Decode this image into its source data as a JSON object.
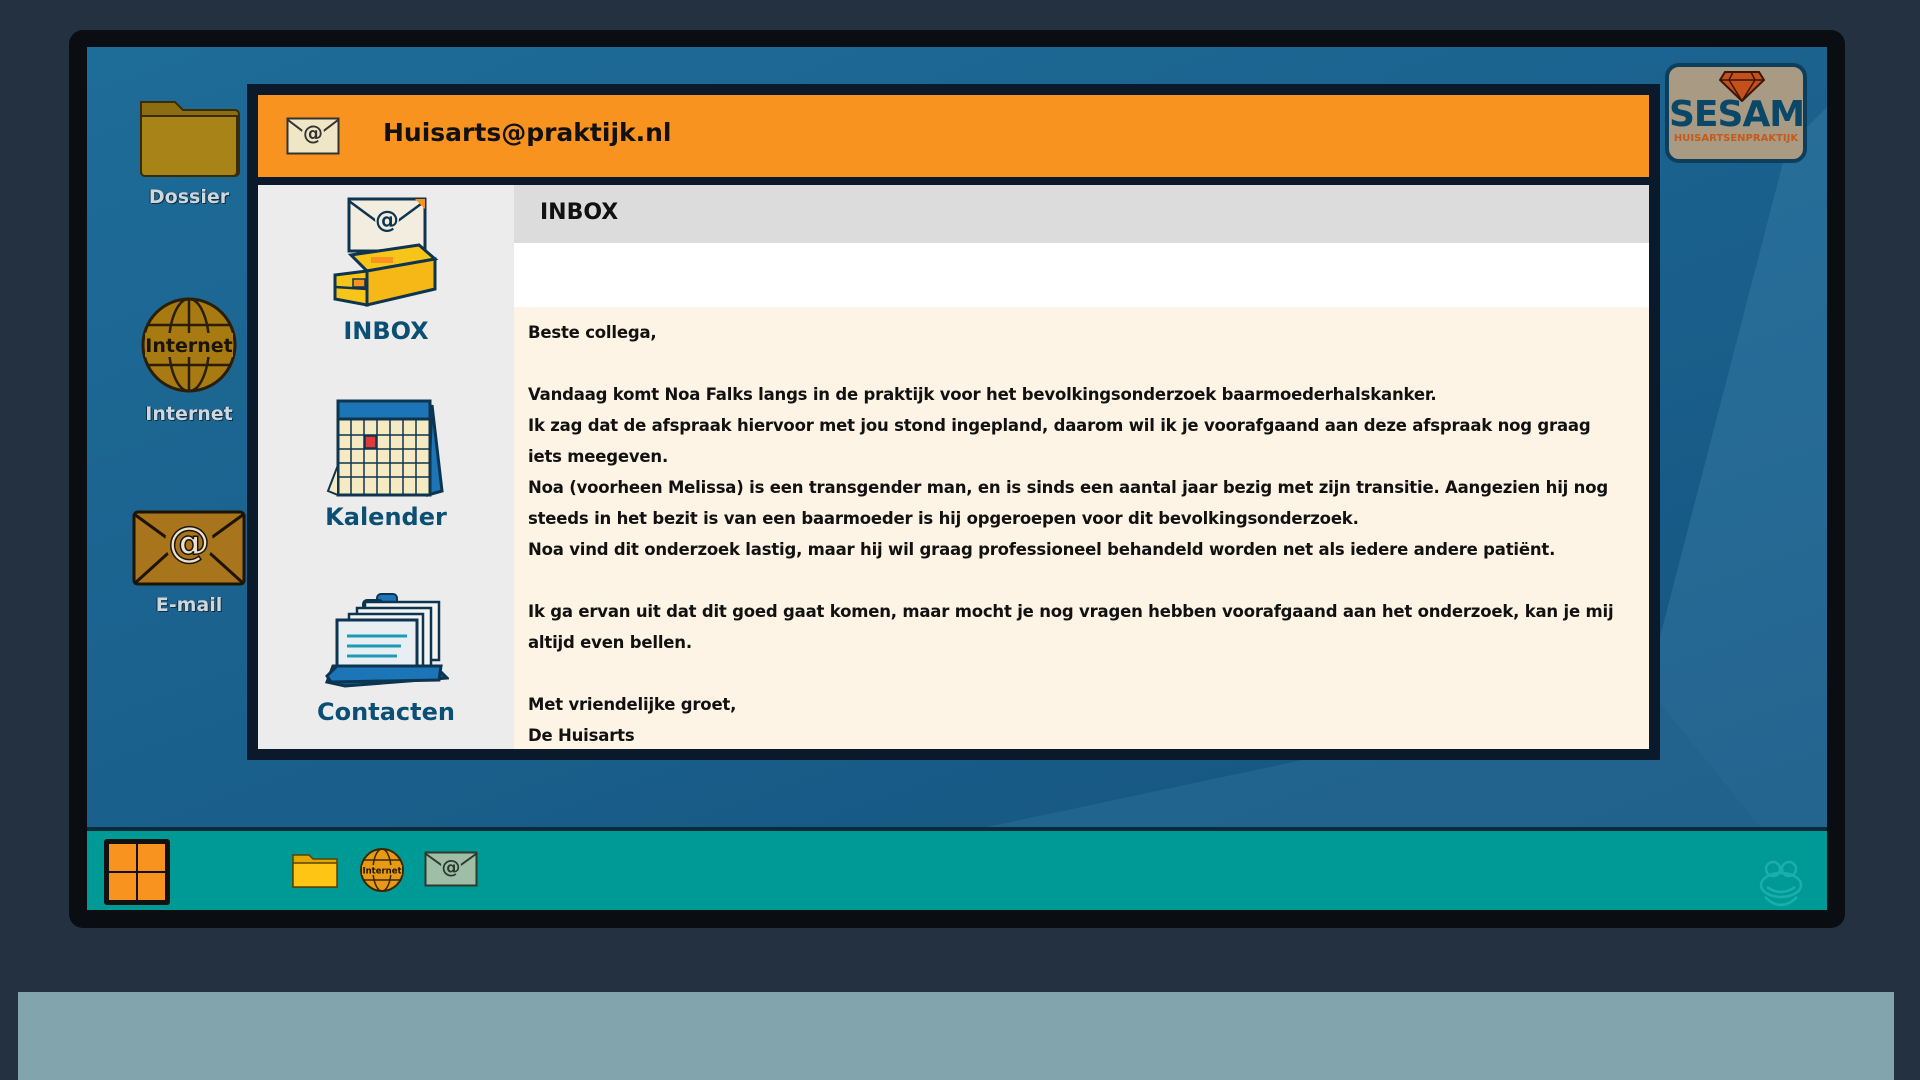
{
  "desktop": {
    "icons": [
      {
        "label": "Dossier",
        "icon": "folder-icon"
      },
      {
        "label": "Internet",
        "icon": "globe-icon"
      },
      {
        "label": "E-mail",
        "icon": "mail-icon"
      }
    ]
  },
  "logo": {
    "title": "SESAM",
    "subtitle": "HUISARTSENPRAKTIJK"
  },
  "window": {
    "title": "Huisarts@praktijk.nl",
    "nav": [
      {
        "label": "INBOX"
      },
      {
        "label": "Kalender"
      },
      {
        "label": "Contacten"
      }
    ],
    "inbox_header": "INBOX",
    "message": {
      "greeting": "Beste collega,",
      "line1": "Vandaag komt Noa Falks langs in de praktijk voor het bevolkingsonderzoek baarmoederhalskanker.",
      "line2": "Ik zag dat de afspraak hiervoor met jou stond ingepland, daarom wil ik je voorafgaand aan deze afspraak nog graag iets meegeven.",
      "line3": "Noa (voorheen Melissa) is een transgender man, en is sinds een aantal jaar bezig met zijn transitie. Aangezien hij nog steeds in het bezit is van een baarmoeder is hij opgeroepen voor dit bevolkingsonderzoek.",
      "line4": "Noa vind dit onderzoek lastig, maar hij wil graag professioneel behandeld worden net als iedere andere patiënt.",
      "line5": "Ik ga ervan uit dat dit goed gaat komen, maar mocht je nog vragen hebben voorafgaand aan het onderzoek, kan je mij altijd even bellen.",
      "closing": "Met vriendelijke groet,",
      "signature": "De Huisarts"
    }
  },
  "taskbar": {
    "globe_text": "Internet",
    "apps": [
      "folder-icon",
      "globe-icon",
      "mail-icon"
    ]
  },
  "colors": {
    "accent": "#f7931e",
    "taskbar": "#009a96",
    "nav_label": "#0b4f74",
    "desktop": "#1e6c98"
  }
}
